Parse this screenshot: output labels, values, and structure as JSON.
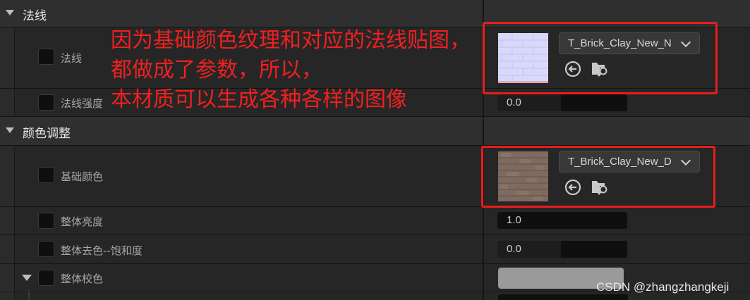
{
  "sections": {
    "normal": {
      "title": "法线"
    },
    "color": {
      "title": "颜色调整"
    }
  },
  "rows": {
    "normal_map": {
      "label": "法线",
      "texture": "T_Brick_Clay_New_N"
    },
    "normal_strength": {
      "label": "法线强度",
      "value": "0.0"
    },
    "base_color": {
      "label": "基础颜色",
      "texture": "T_Brick_Clay_New_D"
    },
    "brightness": {
      "label": "整体亮度",
      "value": "1.0"
    },
    "desaturation": {
      "label": "整体去色--饱和度",
      "value": "0.0"
    },
    "tint": {
      "label": "整体校色"
    }
  },
  "annotation": {
    "line1": "因为基础颜色纹理和对应的法线贴图，",
    "line2": "都做成了参数，所以，",
    "line3": "本材质可以生成各种各样的图像",
    "color": "#f02020"
  },
  "watermark": "CSDN @zhangzhangkeji",
  "icons": {
    "use_selected": "arrow-left-circle-icon",
    "browse": "folder-search-icon",
    "expand": "triangle-down-icon"
  }
}
